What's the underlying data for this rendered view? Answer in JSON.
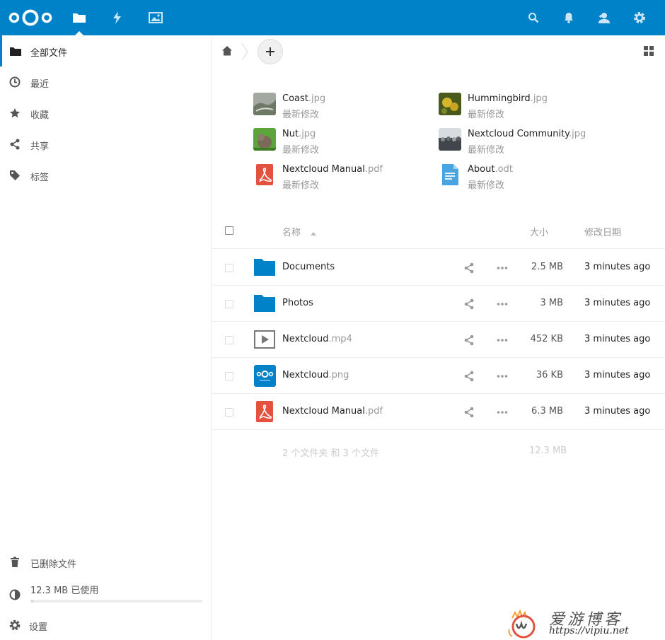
{
  "colors": {
    "brand": "#0082c9",
    "pdf": "#e2523f",
    "folder": "#0082c9"
  },
  "header": {
    "icons": [
      "files-icon",
      "activity-icon",
      "gallery-icon",
      "search-icon",
      "notifications-icon",
      "contacts-icon",
      "settings-icon"
    ]
  },
  "sidebar": {
    "items": [
      {
        "label": "全部文件",
        "icon": "folder-icon"
      },
      {
        "label": "最近",
        "icon": "clock-icon"
      },
      {
        "label": "收藏",
        "icon": "star-icon"
      },
      {
        "label": "共享",
        "icon": "share-icon"
      },
      {
        "label": "标签",
        "icon": "tag-icon"
      }
    ],
    "trash_label": "已删除文件",
    "quota_label": "12.3 MB 已使用",
    "quota_fraction": 0.02,
    "settings_label": "设置"
  },
  "recent": [
    {
      "name": "Coast",
      "ext": ".jpg",
      "sub": "最新修改"
    },
    {
      "name": "Hummingbird",
      "ext": ".jpg",
      "sub": "最新修改"
    },
    {
      "name": "Nut",
      "ext": ".jpg",
      "sub": "最新修改"
    },
    {
      "name": "Nextcloud Community",
      "ext": ".jpg",
      "sub": "最新修改"
    },
    {
      "name": "Nextcloud Manual",
      "ext": ".pdf",
      "sub": "最新修改"
    },
    {
      "name": "About",
      "ext": ".odt",
      "sub": "最新修改"
    }
  ],
  "table": {
    "col_name": "名称",
    "col_size": "大小",
    "col_modified": "修改日期",
    "rows": [
      {
        "name": "Documents",
        "ext": "",
        "size": "2.5 MB",
        "date": "3 minutes ago"
      },
      {
        "name": "Photos",
        "ext": "",
        "size": "3 MB",
        "date": "3 minutes ago"
      },
      {
        "name": "Nextcloud",
        "ext": ".mp4",
        "size": "452 KB",
        "date": "3 minutes ago"
      },
      {
        "name": "Nextcloud",
        "ext": ".png",
        "size": "36 KB",
        "date": "3 minutes ago"
      },
      {
        "name": "Nextcloud Manual",
        "ext": ".pdf",
        "size": "6.3 MB",
        "date": "3 minutes ago"
      }
    ],
    "summary_text": "2 个文件夹 和 3 个文件",
    "summary_size": "12.3 MB"
  },
  "watermark": {
    "title": "爱游博客",
    "url": "https://vipiu.net"
  }
}
